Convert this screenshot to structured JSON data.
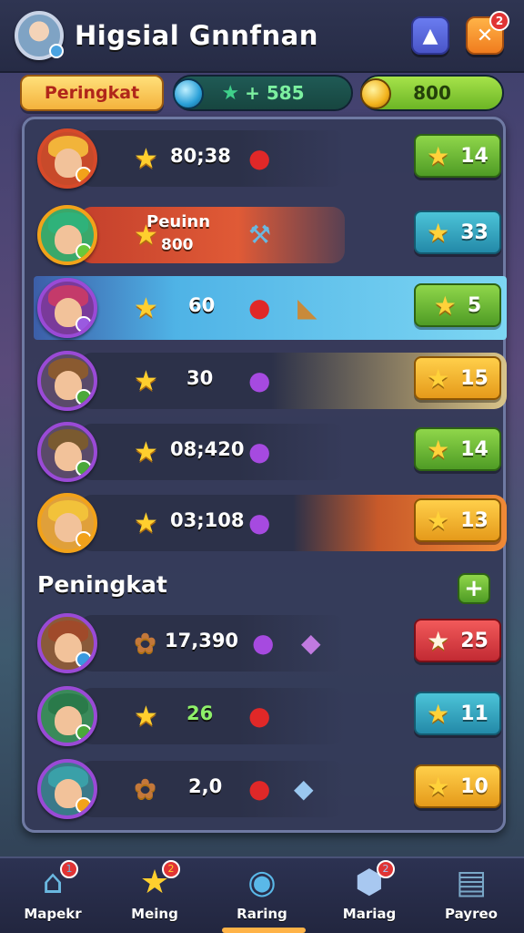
{
  "header": {
    "title": "Higsial Gnnfnan",
    "right_buttons": [
      {
        "icon": "triangle-icon",
        "glyph": "▲"
      },
      {
        "icon": "close-icon",
        "glyph": "✕",
        "badge": "2"
      }
    ]
  },
  "tab": {
    "label": "Peringkat"
  },
  "currencies": [
    {
      "icon": "gem-icon",
      "value": "+ 585"
    },
    {
      "icon": "coin-icon",
      "value": "800"
    }
  ],
  "colors": {
    "accent": "#ffb347",
    "green": "#8fd64a",
    "teal": "#4cc4d8",
    "gold": "#ffcf4a",
    "red": "#f25a5a"
  },
  "rows": [
    {
      "score": "80;38",
      "item1": "apple-icon",
      "rank": "14",
      "style": "green"
    },
    {
      "label": "Peuinn",
      "score": "800",
      "item1": "hammer-icon",
      "rank": "33",
      "style": "teal"
    },
    {
      "score": "60",
      "item1": "apple-icon",
      "item2": "horn-icon",
      "rank": "5",
      "style": "green"
    },
    {
      "score": "30",
      "item1": "plum-icon",
      "rank": "15",
      "style": "gold"
    },
    {
      "score": "08;420",
      "item1": "plum-icon",
      "rank": "14",
      "style": "green"
    },
    {
      "score": "03;108",
      "item1": "plum-icon",
      "rank": "13",
      "style": "gold"
    }
  ],
  "section": {
    "title": "Peningkat",
    "add_label": "+"
  },
  "rows2": [
    {
      "score": "17,390",
      "item1": "plum-icon",
      "item2": "gem-icon",
      "rank": "25",
      "style": "red"
    },
    {
      "score": "26",
      "item1": "apple-icon",
      "rank": "11",
      "style": "teal"
    },
    {
      "score": "2,0",
      "item1": "apple-icon",
      "item2": "crystal-icon",
      "rank": "10",
      "style": "gold"
    }
  ],
  "nav": [
    {
      "label": "Mapekr",
      "icon": "home-icon",
      "badge": "1"
    },
    {
      "label": "Meing",
      "icon": "star-icon",
      "badge": "2"
    },
    {
      "label": "Raring",
      "icon": "fish-icon"
    },
    {
      "label": "Mariag",
      "icon": "dice-icon",
      "badge": "2"
    },
    {
      "label": "Payreo",
      "icon": "clipboard-icon"
    }
  ]
}
